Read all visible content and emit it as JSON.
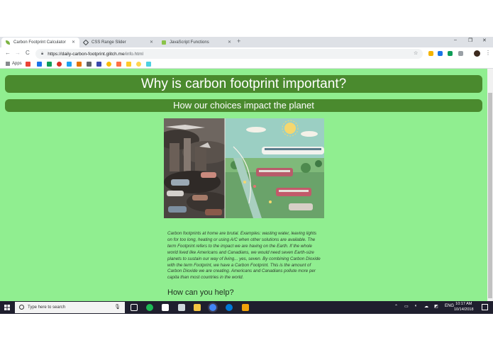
{
  "browser": {
    "tabs": [
      {
        "label": "Carbon Footprint Calculator",
        "active": true,
        "icon_color": "#7cb342"
      },
      {
        "label": "CSS Range Slider",
        "active": false,
        "icon_color": "#3c4043"
      },
      {
        "label": "JavaScript Functions",
        "active": false,
        "icon_color": "#8bc34a"
      }
    ],
    "new_tab": "+",
    "window_controls": {
      "minimize": "–",
      "maximize": "❐",
      "close": "✕"
    },
    "nav": {
      "back": "←",
      "forward": "→",
      "reload": "C"
    },
    "url_host": "https://daily-carbon-footprint.glitch.me",
    "url_path": "/info.html",
    "bookmarks": {
      "apps_label": "Apps"
    }
  },
  "page": {
    "heading": "Why is carbon footprint important?",
    "subheading": "How our choices impact the planet",
    "paragraph": "Carbon footprints at home are brutal. Examples: wasting water, leaving lights on for too long, heating or using A/C when other solutions are available. The term Footprint refers to the impact we are having on the Earth. If the whole world lived like Americans and Canadians, we would need seven Earth-size planets to sustain our way of living... yes, seven. By combining Carbon Dioxide with the term Footprint, we have a Carbon Footprint. This is the amount of Carbon Dioxide we are creating. Americans and Canadians pollute more per capita than most countries in the world.",
    "help_heading": "How can you help?",
    "colors": {
      "background": "#90ee90",
      "heading_bar": "#4a8a2e",
      "heading_text": "#ffffff"
    }
  },
  "taskbar": {
    "search_placeholder": "Type here to search",
    "language": "ENG",
    "time": "10:17 AM",
    "date": "10/14/2018"
  }
}
